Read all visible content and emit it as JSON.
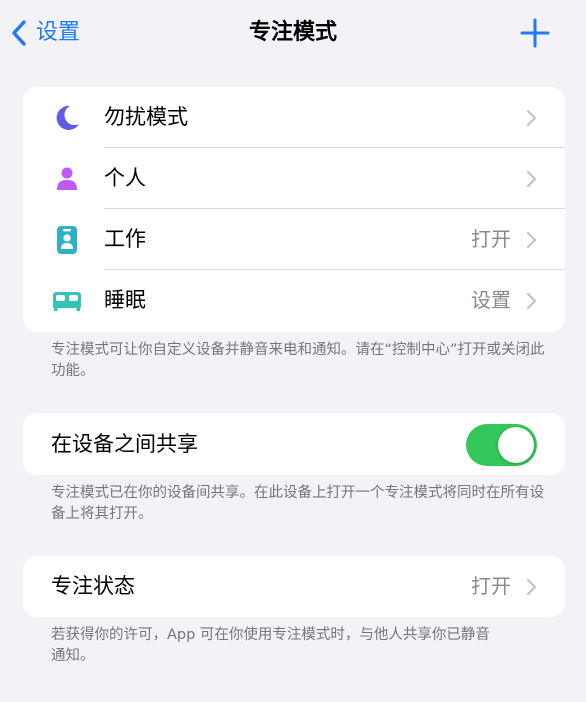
{
  "nav": {
    "back_label": "设置",
    "title": "专注模式"
  },
  "focus_modes": [
    {
      "label": "勿扰模式",
      "value": "",
      "icon": "moon-icon",
      "color": "#5e5ce6"
    },
    {
      "label": "个人",
      "value": "",
      "icon": "person-icon",
      "color": "#bf5af2"
    },
    {
      "label": "工作",
      "value": "打开",
      "icon": "id-badge-icon",
      "color": "#30b0c7"
    },
    {
      "label": "睡眠",
      "value": "设置",
      "icon": "bed-icon",
      "color": "#34c3b4"
    }
  ],
  "focus_modes_footnote": "专注模式可让你自定义设备并静音来电和通知。请在“控制中心”打开或关闭此功能。",
  "share": {
    "label": "在设备之间共享",
    "enabled": true,
    "footnote": "专注模式已在你的设备间共享。在此设备上打开一个专注模式将同时在所有设备上将其打开。"
  },
  "focus_status": {
    "label": "专注状态",
    "value": "打开",
    "footnote": "若获得你的许可，App 可在你使用专注模式时，与他人共享你已静音通知。"
  },
  "colors": {
    "accent": "#1f7af5",
    "toggle_on": "#34c759",
    "background": "#f2f2f7"
  }
}
